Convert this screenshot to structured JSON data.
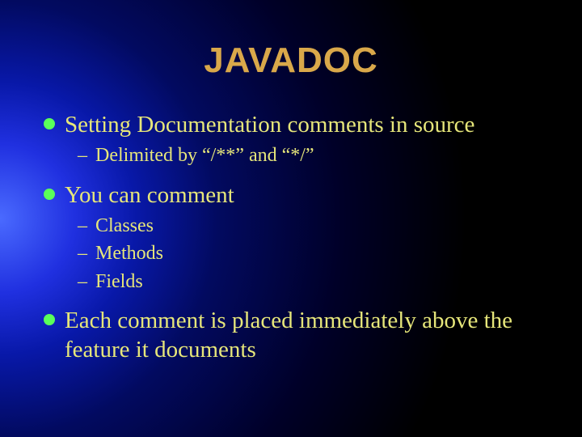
{
  "title": "JAVADOC",
  "bullets": [
    {
      "text": "Setting Documentation comments in source",
      "sub": [
        "Delimited by “/**” and “*/”"
      ]
    },
    {
      "text": "You can comment",
      "sub": [
        "Classes",
        "Methods",
        "Fields"
      ]
    },
    {
      "text": "Each comment is placed immediately above the feature it documents",
      "sub": []
    }
  ]
}
